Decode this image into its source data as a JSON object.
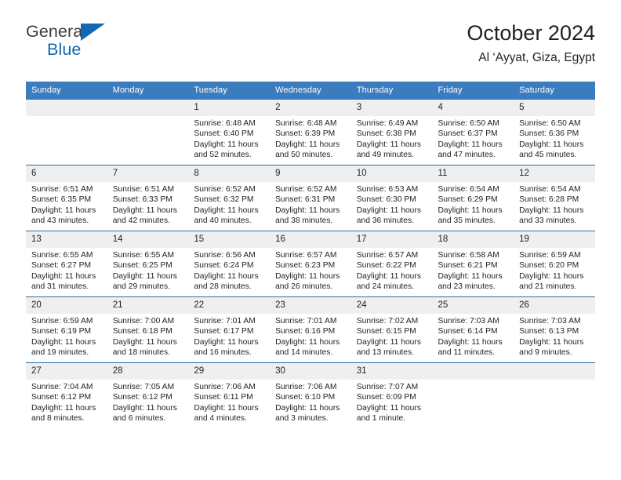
{
  "brand": {
    "line1": "General",
    "line2": "Blue",
    "triangle_color": "#1268b3"
  },
  "header": {
    "title": "October 2024",
    "subtitle": "Al ‘Ayyat, Giza, Egypt"
  },
  "theme": {
    "header_bg": "#3a7cbe",
    "row_rule": "#2e6da4",
    "daynum_bg": "#efefef",
    "text": "#231f20"
  },
  "weekdays": [
    "Sunday",
    "Monday",
    "Tuesday",
    "Wednesday",
    "Thursday",
    "Friday",
    "Saturday"
  ],
  "weeks": [
    [
      {
        "day": "",
        "sunrise": "",
        "sunset": "",
        "daylight": ""
      },
      {
        "day": "",
        "sunrise": "",
        "sunset": "",
        "daylight": ""
      },
      {
        "day": "1",
        "sunrise": "Sunrise: 6:48 AM",
        "sunset": "Sunset: 6:40 PM",
        "daylight": "Daylight: 11 hours and 52 minutes."
      },
      {
        "day": "2",
        "sunrise": "Sunrise: 6:48 AM",
        "sunset": "Sunset: 6:39 PM",
        "daylight": "Daylight: 11 hours and 50 minutes."
      },
      {
        "day": "3",
        "sunrise": "Sunrise: 6:49 AM",
        "sunset": "Sunset: 6:38 PM",
        "daylight": "Daylight: 11 hours and 49 minutes."
      },
      {
        "day": "4",
        "sunrise": "Sunrise: 6:50 AM",
        "sunset": "Sunset: 6:37 PM",
        "daylight": "Daylight: 11 hours and 47 minutes."
      },
      {
        "day": "5",
        "sunrise": "Sunrise: 6:50 AM",
        "sunset": "Sunset: 6:36 PM",
        "daylight": "Daylight: 11 hours and 45 minutes."
      }
    ],
    [
      {
        "day": "6",
        "sunrise": "Sunrise: 6:51 AM",
        "sunset": "Sunset: 6:35 PM",
        "daylight": "Daylight: 11 hours and 43 minutes."
      },
      {
        "day": "7",
        "sunrise": "Sunrise: 6:51 AM",
        "sunset": "Sunset: 6:33 PM",
        "daylight": "Daylight: 11 hours and 42 minutes."
      },
      {
        "day": "8",
        "sunrise": "Sunrise: 6:52 AM",
        "sunset": "Sunset: 6:32 PM",
        "daylight": "Daylight: 11 hours and 40 minutes."
      },
      {
        "day": "9",
        "sunrise": "Sunrise: 6:52 AM",
        "sunset": "Sunset: 6:31 PM",
        "daylight": "Daylight: 11 hours and 38 minutes."
      },
      {
        "day": "10",
        "sunrise": "Sunrise: 6:53 AM",
        "sunset": "Sunset: 6:30 PM",
        "daylight": "Daylight: 11 hours and 36 minutes."
      },
      {
        "day": "11",
        "sunrise": "Sunrise: 6:54 AM",
        "sunset": "Sunset: 6:29 PM",
        "daylight": "Daylight: 11 hours and 35 minutes."
      },
      {
        "day": "12",
        "sunrise": "Sunrise: 6:54 AM",
        "sunset": "Sunset: 6:28 PM",
        "daylight": "Daylight: 11 hours and 33 minutes."
      }
    ],
    [
      {
        "day": "13",
        "sunrise": "Sunrise: 6:55 AM",
        "sunset": "Sunset: 6:27 PM",
        "daylight": "Daylight: 11 hours and 31 minutes."
      },
      {
        "day": "14",
        "sunrise": "Sunrise: 6:55 AM",
        "sunset": "Sunset: 6:25 PM",
        "daylight": "Daylight: 11 hours and 29 minutes."
      },
      {
        "day": "15",
        "sunrise": "Sunrise: 6:56 AM",
        "sunset": "Sunset: 6:24 PM",
        "daylight": "Daylight: 11 hours and 28 minutes."
      },
      {
        "day": "16",
        "sunrise": "Sunrise: 6:57 AM",
        "sunset": "Sunset: 6:23 PM",
        "daylight": "Daylight: 11 hours and 26 minutes."
      },
      {
        "day": "17",
        "sunrise": "Sunrise: 6:57 AM",
        "sunset": "Sunset: 6:22 PM",
        "daylight": "Daylight: 11 hours and 24 minutes."
      },
      {
        "day": "18",
        "sunrise": "Sunrise: 6:58 AM",
        "sunset": "Sunset: 6:21 PM",
        "daylight": "Daylight: 11 hours and 23 minutes."
      },
      {
        "day": "19",
        "sunrise": "Sunrise: 6:59 AM",
        "sunset": "Sunset: 6:20 PM",
        "daylight": "Daylight: 11 hours and 21 minutes."
      }
    ],
    [
      {
        "day": "20",
        "sunrise": "Sunrise: 6:59 AM",
        "sunset": "Sunset: 6:19 PM",
        "daylight": "Daylight: 11 hours and 19 minutes."
      },
      {
        "day": "21",
        "sunrise": "Sunrise: 7:00 AM",
        "sunset": "Sunset: 6:18 PM",
        "daylight": "Daylight: 11 hours and 18 minutes."
      },
      {
        "day": "22",
        "sunrise": "Sunrise: 7:01 AM",
        "sunset": "Sunset: 6:17 PM",
        "daylight": "Daylight: 11 hours and 16 minutes."
      },
      {
        "day": "23",
        "sunrise": "Sunrise: 7:01 AM",
        "sunset": "Sunset: 6:16 PM",
        "daylight": "Daylight: 11 hours and 14 minutes."
      },
      {
        "day": "24",
        "sunrise": "Sunrise: 7:02 AM",
        "sunset": "Sunset: 6:15 PM",
        "daylight": "Daylight: 11 hours and 13 minutes."
      },
      {
        "day": "25",
        "sunrise": "Sunrise: 7:03 AM",
        "sunset": "Sunset: 6:14 PM",
        "daylight": "Daylight: 11 hours and 11 minutes."
      },
      {
        "day": "26",
        "sunrise": "Sunrise: 7:03 AM",
        "sunset": "Sunset: 6:13 PM",
        "daylight": "Daylight: 11 hours and 9 minutes."
      }
    ],
    [
      {
        "day": "27",
        "sunrise": "Sunrise: 7:04 AM",
        "sunset": "Sunset: 6:12 PM",
        "daylight": "Daylight: 11 hours and 8 minutes."
      },
      {
        "day": "28",
        "sunrise": "Sunrise: 7:05 AM",
        "sunset": "Sunset: 6:12 PM",
        "daylight": "Daylight: 11 hours and 6 minutes."
      },
      {
        "day": "29",
        "sunrise": "Sunrise: 7:06 AM",
        "sunset": "Sunset: 6:11 PM",
        "daylight": "Daylight: 11 hours and 4 minutes."
      },
      {
        "day": "30",
        "sunrise": "Sunrise: 7:06 AM",
        "sunset": "Sunset: 6:10 PM",
        "daylight": "Daylight: 11 hours and 3 minutes."
      },
      {
        "day": "31",
        "sunrise": "Sunrise: 7:07 AM",
        "sunset": "Sunset: 6:09 PM",
        "daylight": "Daylight: 11 hours and 1 minute."
      },
      {
        "day": "",
        "sunrise": "",
        "sunset": "",
        "daylight": ""
      },
      {
        "day": "",
        "sunrise": "",
        "sunset": "",
        "daylight": ""
      }
    ]
  ]
}
